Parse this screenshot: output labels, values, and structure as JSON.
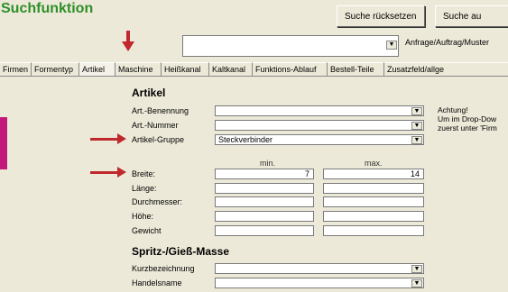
{
  "window": {
    "title": "Suchfunktion"
  },
  "toolbar": {
    "reset_label": "Suche rücksetzen",
    "search_label": "Suche au"
  },
  "query": {
    "value": "",
    "label": "Anfrage/Auftrag/Muster"
  },
  "tabs": [
    {
      "label": "Firmen"
    },
    {
      "label": "Formentyp"
    },
    {
      "label": "Artikel"
    },
    {
      "label": "Maschine"
    },
    {
      "label": "Heißkanal"
    },
    {
      "label": "Kaltkanal"
    },
    {
      "label": "Funktions-Ablauf"
    },
    {
      "label": "Bestell-Teile"
    },
    {
      "label": "Zusatzfeld/allge"
    }
  ],
  "artikel": {
    "heading": "Artikel",
    "benennung_label": "Art.-Benennung",
    "benennung_value": "",
    "nummer_label": "Art.-Nummer",
    "nummer_value": "",
    "gruppe_label": "Artikel-Gruppe",
    "gruppe_value": "Steckverbinder"
  },
  "note": {
    "line1": "Achtung!",
    "line2": "Um im Drop-Dow",
    "line3": "zuerst unter 'Firm"
  },
  "ranges": {
    "min_header": "min.",
    "max_header": "max.",
    "rows": [
      {
        "label": "Breite:",
        "min": "7",
        "max": "14"
      },
      {
        "label": "Länge:",
        "min": "",
        "max": ""
      },
      {
        "label": "Durchmesser:",
        "min": "",
        "max": ""
      },
      {
        "label": "Höhe:",
        "min": "",
        "max": ""
      },
      {
        "label": "Gewicht",
        "min": "",
        "max": ""
      }
    ]
  },
  "masse": {
    "heading": "Spritz-/Gieß-Masse",
    "kurz_label": "Kurzbezeichnung",
    "kurz_value": "",
    "handel_label": "Handelsname",
    "handel_value": ""
  },
  "colors": {
    "arrow": "#c0282d",
    "title": "#2f8f2a",
    "accent_bar": "#c2187a"
  }
}
